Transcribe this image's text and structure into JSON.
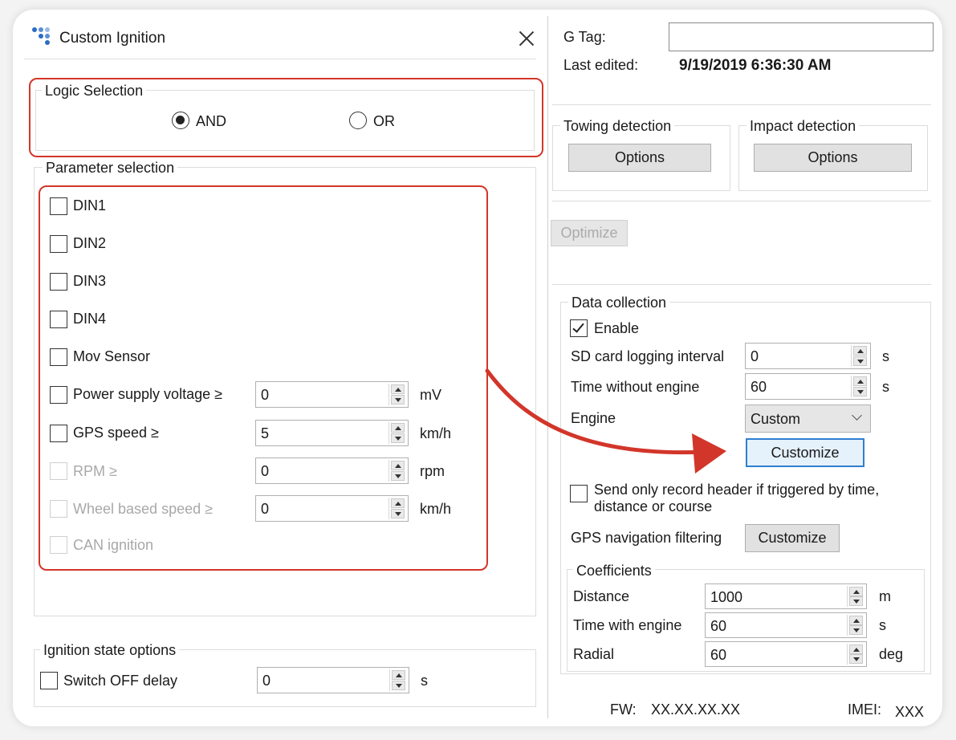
{
  "dialog": {
    "title": "Custom Ignition",
    "logic": {
      "legend": "Logic Selection",
      "options": [
        {
          "label": "AND",
          "selected": true
        },
        {
          "label": "OR",
          "selected": false
        }
      ]
    },
    "params": {
      "legend": "Parameter selection",
      "items": [
        {
          "label": "DIN1"
        },
        {
          "label": "DIN2"
        },
        {
          "label": "DIN3"
        },
        {
          "label": "DIN4"
        },
        {
          "label": "Mov Sensor"
        },
        {
          "label": "Power supply voltage ≥",
          "value": "0",
          "unit": "mV"
        },
        {
          "label": "GPS speed ≥",
          "value": "5",
          "unit": "km/h"
        },
        {
          "label": "RPM ≥",
          "value": "0",
          "unit": "rpm"
        },
        {
          "label": "Wheel based speed ≥",
          "value": "0",
          "unit": "km/h"
        },
        {
          "label": "CAN ignition"
        }
      ]
    },
    "ignition": {
      "legend": "Ignition state options",
      "switch_label": "Switch OFF delay",
      "switch_value": "0",
      "switch_unit": "s"
    }
  },
  "right": {
    "gtag_label": "G Tag:",
    "gtag_value": "",
    "last_edited_label": "Last edited:",
    "last_edited_value": "9/19/2019 6:36:30 AM",
    "towing": {
      "legend": "Towing detection",
      "button": "Options"
    },
    "impact": {
      "legend": "Impact detection",
      "button": "Options"
    },
    "optimize": "Optimize",
    "data_collection": {
      "legend": "Data collection",
      "enable_label": "Enable",
      "sd_label": "SD card logging interval",
      "sd_value": "0",
      "sd_unit": "s",
      "twe_label": "Time without engine",
      "twe_value": "60",
      "twe_unit": "s",
      "engine_label": "Engine",
      "engine_value": "Custom",
      "customize": "Customize",
      "header_label_1": "Send only record header if triggered by time,",
      "header_label_2": "distance or course",
      "gps_label": "GPS navigation filtering",
      "gps_button": "Customize"
    },
    "coefficients": {
      "legend": "Coefficients",
      "distance_label": "Distance",
      "distance_value": "1000",
      "distance_unit": "m",
      "twe_label": "Time with engine",
      "twe_value": "60",
      "twe_unit": "s",
      "radial_label": "Radial",
      "radial_value": "60",
      "radial_unit": "deg"
    },
    "fw_label": "FW:",
    "fw_value": "XX.XX.XX.XX",
    "imei_label": "IMEI:",
    "imei_value": "XXX"
  },
  "colors": {
    "highlight": "#d2362a",
    "focus": "#2f7fd1"
  }
}
